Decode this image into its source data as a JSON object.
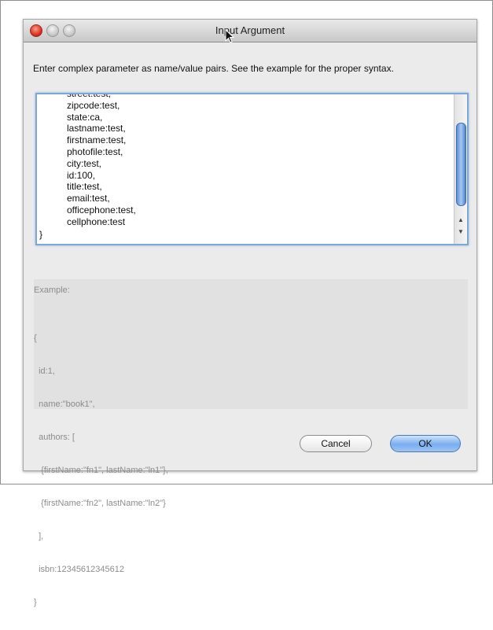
{
  "dialog": {
    "title": "Input Argument",
    "instruction": "Enter complex parameter as name/value pairs. See the example for the proper syntax."
  },
  "textarea": {
    "lines": [
      "street:test,",
      "zipcode:test,",
      "state:ca,",
      "lastname:test,",
      "firstname:test,",
      "photofile:test,",
      "city:test,",
      "id:100,",
      "title:test,",
      "email:test,",
      "officephone:test,",
      "cellphone:test"
    ],
    "cursor_line": "}"
  },
  "example": {
    "label": "Example:",
    "code": [
      "{",
      "  id:1,",
      "  name:\"book1\",",
      "  authors: [",
      "   {firstName:\"fn1\", lastName:\"ln1\"},",
      "   {firstName:\"fn2\", lastName:\"ln2\"}",
      "  ],",
      "  isbn:12345612345612",
      "}"
    ]
  },
  "buttons": {
    "cancel": "Cancel",
    "ok": "OK"
  },
  "colors": {
    "default_button": "#79aef0",
    "focus_ring": "#7fa6d6",
    "close_light": "#d9341e"
  },
  "icons": {
    "close": "close-icon",
    "minimize": "minimize-icon",
    "zoom": "zoom-icon",
    "pointer": "mouse-pointer-icon"
  }
}
